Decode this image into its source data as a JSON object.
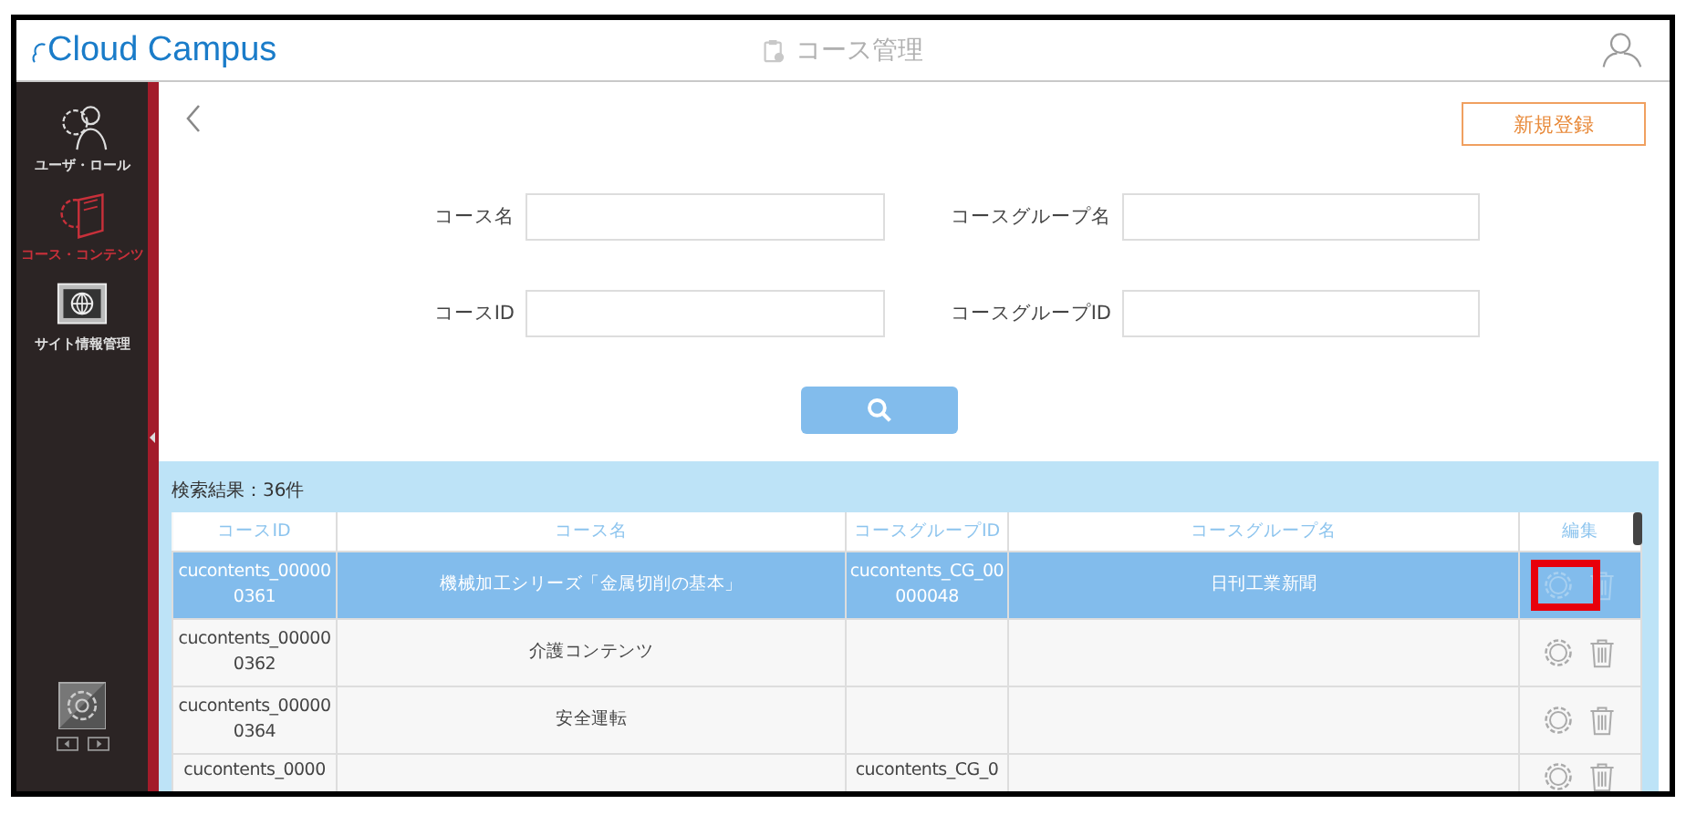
{
  "header": {
    "logo": "Cloud Campus",
    "title": "コース管理"
  },
  "sidebar": {
    "items": [
      {
        "label": "ユーザ・ロール",
        "kind": "users",
        "selected": false
      },
      {
        "label": "コース・コンテンツ",
        "kind": "contents",
        "selected": true
      },
      {
        "label": "サイト情報管理",
        "kind": "site",
        "selected": false
      }
    ]
  },
  "toolbar": {
    "new_button": "新規登録"
  },
  "search_form": {
    "fields": [
      {
        "label": "コース名"
      },
      {
        "label": "コースグループ名"
      },
      {
        "label": "コースID"
      },
      {
        "label": "コースグループID"
      }
    ]
  },
  "results": {
    "summary": "検索結果：36件",
    "columns": [
      "コースID",
      "コース名",
      "コースグループID",
      "コースグループ名",
      "編集"
    ],
    "rows": [
      {
        "course_id": "cucontents_000000361",
        "course_name": "機械加工シリーズ「金属切削の基本」",
        "group_id": "cucontents_CG_00000048",
        "group_name": "日刊工業新聞",
        "selected": true,
        "highlighted": true
      },
      {
        "course_id": "cucontents_000000362",
        "course_name": "介護コンテンツ",
        "selected": false,
        "highlighted": false
      },
      {
        "course_id": "cucontents_000000364",
        "course_name": "安全運転",
        "selected": false,
        "highlighted": false
      },
      {
        "course_id": "cucontents_0000",
        "group_id": "cucontents_CG_0",
        "selected": false,
        "highlighted": false
      }
    ]
  }
}
